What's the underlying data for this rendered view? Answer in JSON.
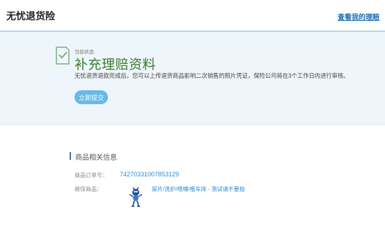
{
  "header": {
    "title": "无忧退货险",
    "claims_link": "查看我的理赔"
  },
  "status": {
    "label": "当前状态",
    "title": "补充理赔资料",
    "description": "无忧退货退款完成后，您可以上传退货商品影响二次销售的照片凭证，保险公司将在3个工作日内进行审核。",
    "submit_label": "立即提交"
  },
  "goods_info": {
    "section_title": "商品相关信息",
    "order_label": "商品订单号：",
    "order_number": "74270331007853129",
    "goods_label": "被保商品：",
    "goods_name": "尿片/洗护/喂哺/推车床 - 测试请不要拍"
  },
  "colors": {
    "accent": "#68b9e6",
    "title_green": "#3d7a2f",
    "link_blue": "#2a8bd3"
  }
}
